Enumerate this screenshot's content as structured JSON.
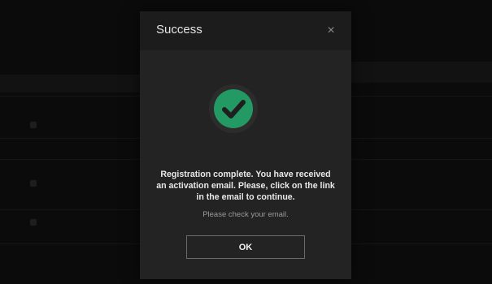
{
  "modal": {
    "title": "Success",
    "close_glyph": "×",
    "icon": "check-circle-icon",
    "icon_color": "#239964",
    "message": "Registration complete. You have received an activation email. Please, click on the link in the email to continue.",
    "submessage": "Please check your email.",
    "ok_label": "OK"
  }
}
